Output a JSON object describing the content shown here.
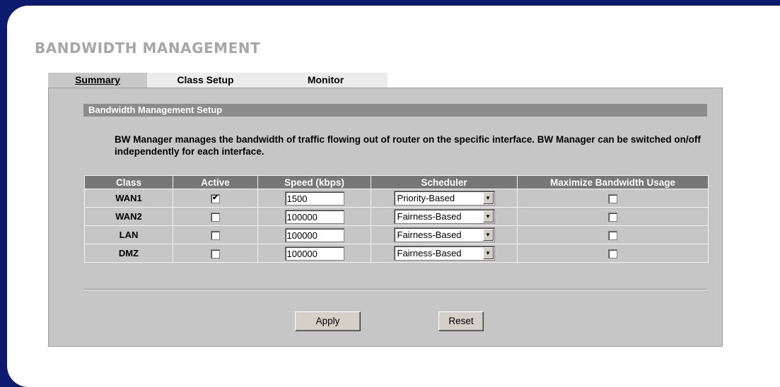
{
  "page_title": "BANDWIDTH MANAGEMENT",
  "tabs": [
    {
      "label": "Summary",
      "active": true
    },
    {
      "label": "Class Setup",
      "active": false
    },
    {
      "label": "Monitor",
      "active": false
    }
  ],
  "section_title": "Bandwidth Management Setup",
  "description": "BW Manager manages the bandwidth of traffic flowing out of router on the specific interface. BW Manager can be switched on/off independently for each interface.",
  "table": {
    "headers": [
      "Class",
      "Active",
      "Speed (kbps)",
      "Scheduler",
      "Maximize Bandwidth Usage"
    ],
    "rows": [
      {
        "class": "WAN1",
        "active": true,
        "speed": "1500",
        "scheduler": "Priority-Based",
        "maximize": false
      },
      {
        "class": "WAN2",
        "active": false,
        "speed": "100000",
        "scheduler": "Fairness-Based",
        "maximize": false
      },
      {
        "class": "LAN",
        "active": false,
        "speed": "100000",
        "scheduler": "Fairness-Based",
        "maximize": false
      },
      {
        "class": "DMZ",
        "active": false,
        "speed": "100000",
        "scheduler": "Fairness-Based",
        "maximize": false
      }
    ]
  },
  "buttons": {
    "apply": "Apply",
    "reset": "Reset"
  },
  "colors": {
    "window_bg": "#0d1b6e",
    "panel_bg": "#c6c6c6",
    "header_bg": "#777777",
    "section_bar": "#8c8c8c",
    "title_gray": "#a7a7a7"
  }
}
